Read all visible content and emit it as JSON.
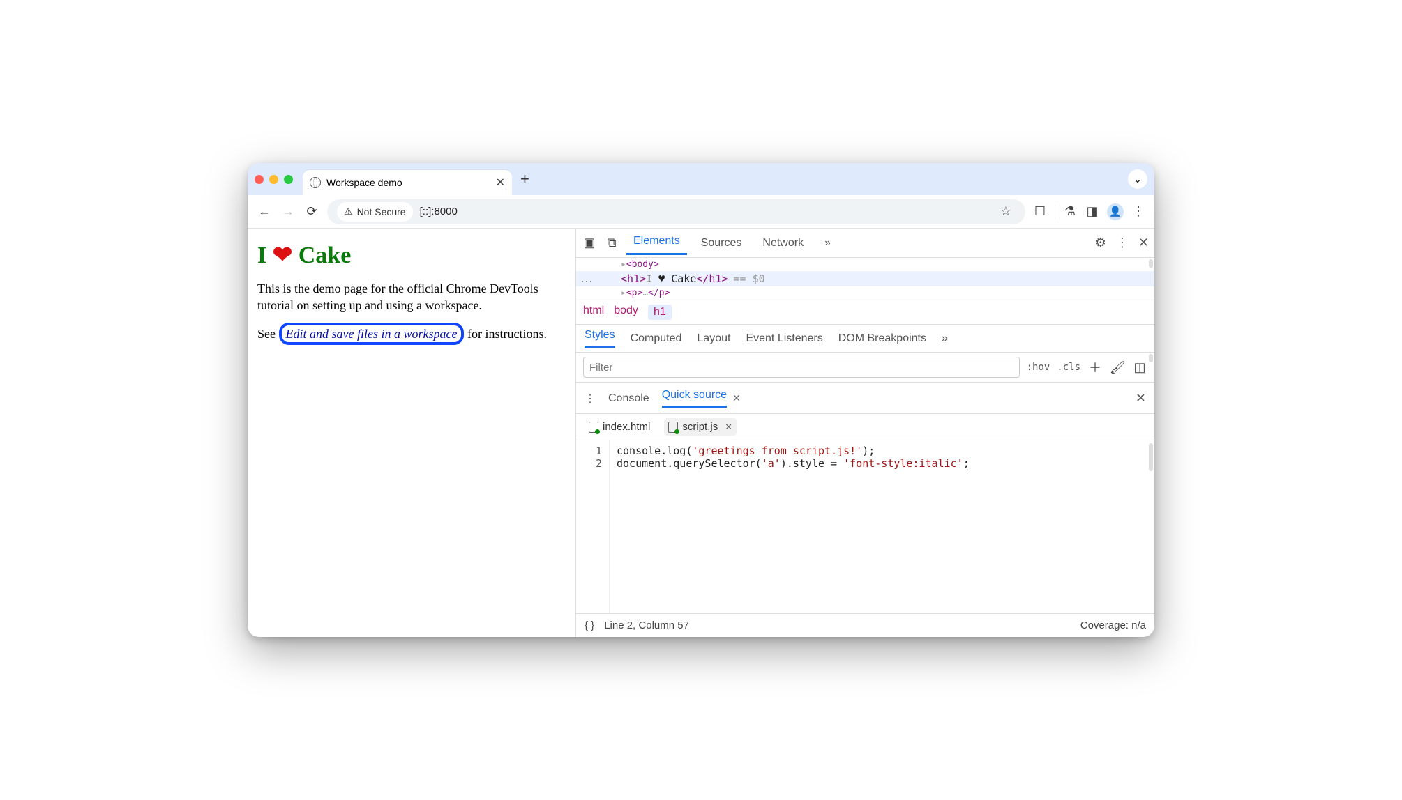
{
  "browser": {
    "tab_title": "Workspace demo",
    "security_label": "Not Secure",
    "url": "[::]:8000"
  },
  "page": {
    "h1_word1": "I",
    "h1_heart": "❤",
    "h1_word3": "Cake",
    "para1": "This is the demo page for the official Chrome DevTools tutorial on setting up and using a workspace.",
    "para2_prefix": "See ",
    "para2_link": "Edit and save files in a workspace",
    "para2_suffix": " for instructions."
  },
  "devtools": {
    "main_tabs": [
      "Elements",
      "Sources",
      "Network"
    ],
    "dom_above": "<body>",
    "dom_h1_open": "<h1>",
    "dom_h1_text": "I ♥ Cake",
    "dom_h1_close": "</h1>",
    "dom_eq": "== $0",
    "dom_below": "<p></p>",
    "breadcrumbs": [
      "html",
      "body",
      "h1"
    ],
    "styles_tabs": [
      "Styles",
      "Computed",
      "Layout",
      "Event Listeners",
      "DOM Breakpoints"
    ],
    "filter_placeholder": "Filter",
    "hov": ":hov",
    "cls": ".cls",
    "drawer_tabs": {
      "console": "Console",
      "quick": "Quick source"
    },
    "files": {
      "index": "index.html",
      "script": "script.js"
    },
    "code": {
      "l1": "console.log('greetings from script.js!');",
      "l2_pre": "document.querySelector(",
      "l2_str1": "'a'",
      "l2_mid": ").style = ",
      "l2_str2": "'font-style:italic'",
      "l2_end": ";",
      "line1": "1",
      "line2": "2",
      "l1_pre": "console.log(",
      "l1_str": "'greetings from script.js!'",
      "l1_end": ");"
    },
    "status_pos": "Line 2, Column 57",
    "status_cov": "Coverage: n/a"
  }
}
